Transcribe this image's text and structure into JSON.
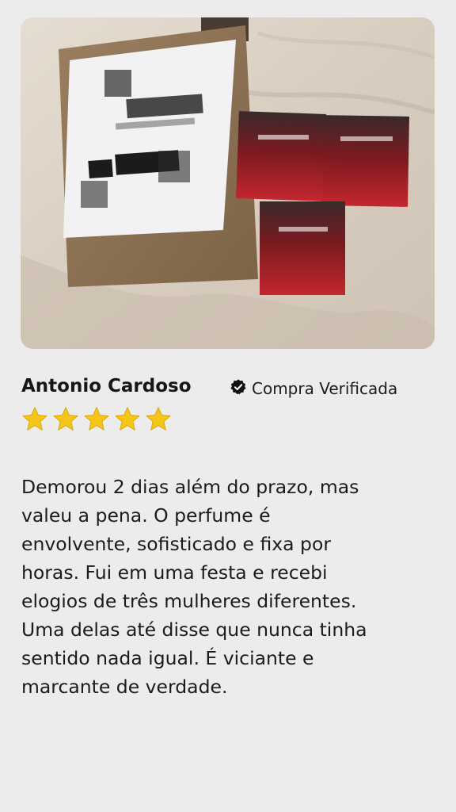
{
  "review": {
    "photo_icon": "product-photo-parcel-and-perfume-boxes",
    "reviewer_name": "Antonio Cardoso",
    "verified_icon": "verified-badge-icon",
    "verified_label": "Compra Verificada",
    "rating": 5,
    "rating_max": 5,
    "star_color": "#f5c518",
    "text_lines": [
      "Demorou 2 dias além do prazo, mas",
      "valeu a pena. O perfume é",
      "envolvente, sofisticado e fixa por",
      "horas. Fui em uma festa e recebi",
      "elogios de três mulheres diferentes.",
      "Uma delas até disse que nunca tinha",
      "sentido nada igual. É viciante e",
      "marcante de verdade."
    ]
  }
}
